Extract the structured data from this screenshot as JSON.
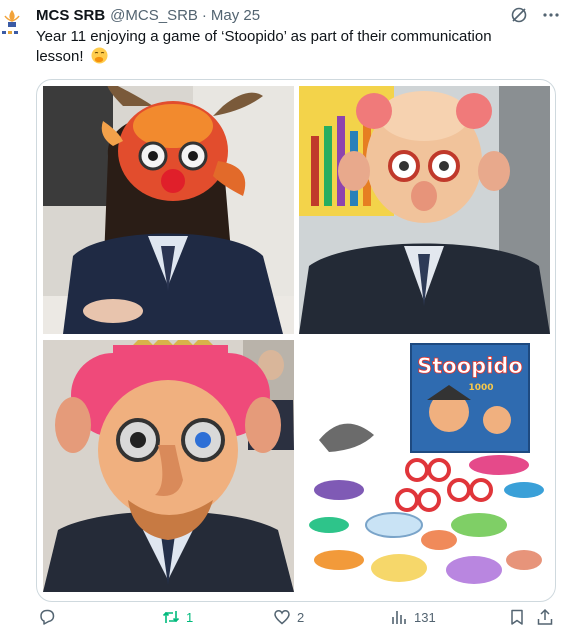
{
  "tweet": {
    "author_name": "MCS SRB",
    "handle": "@MCS_SRB",
    "separator": "·",
    "date": "May 25",
    "text": "Year 11 enjoying a game of ‘Stoopido’ as part of their communication lesson!",
    "emoji": "face-with-hand-over-mouth-emoji"
  },
  "media": {
    "images": [
      {
        "subject": "student-with-bull-mask"
      },
      {
        "subject": "student-with-bald-man-mask"
      },
      {
        "subject": "student-with-curly-hair-mask"
      },
      {
        "subject": "stoopido-game-box-and-pieces",
        "box_title": "Stoopido",
        "box_number": "1000"
      }
    ]
  },
  "actions": {
    "reply": {
      "icon": "reply-icon",
      "count": ""
    },
    "repost": {
      "icon": "repost-icon",
      "count": "1",
      "color": "#00ba7c"
    },
    "like": {
      "icon": "heart-icon",
      "count": "2"
    },
    "views": {
      "icon": "views-icon",
      "count": "131"
    },
    "bookmark": {
      "icon": "bookmark-icon"
    },
    "share": {
      "icon": "share-icon"
    }
  },
  "colors": {
    "text": "#0f1419",
    "secondary": "#536471",
    "border": "#cfd9de",
    "repost_active": "#00ba7c"
  }
}
